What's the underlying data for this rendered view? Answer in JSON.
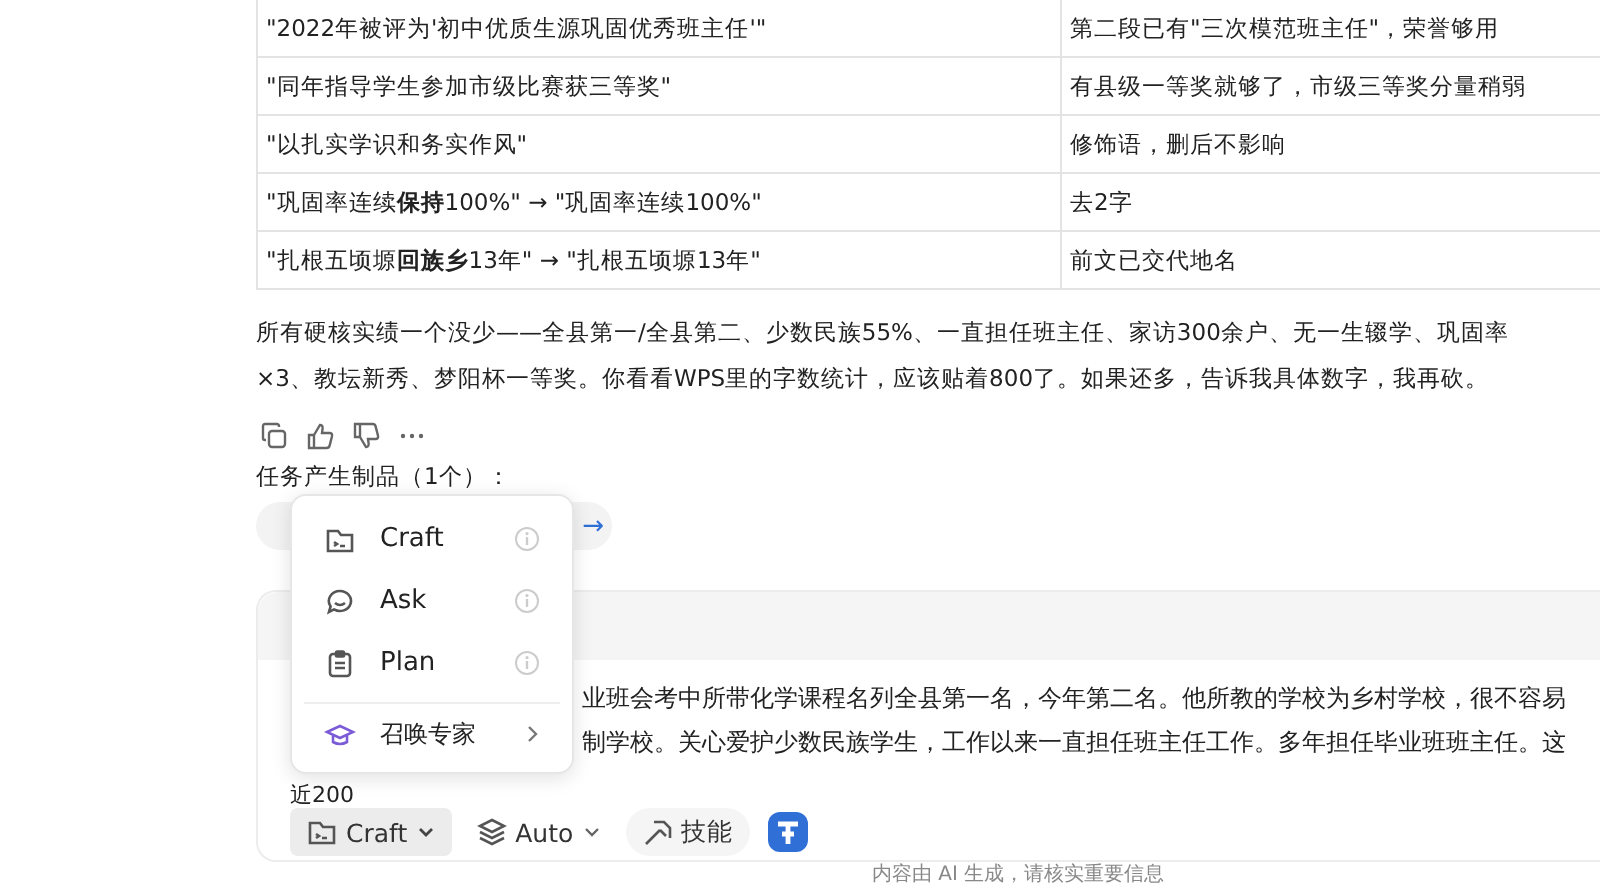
{
  "table": {
    "rows": [
      {
        "cells": [
          "\"2022年被评为'初中优质生源巩固优秀班主任'\"",
          "第二段已有\"三次模范班主任\"，荣誉够用"
        ]
      },
      {
        "cells": [
          "\"同年指导学生参加市级比赛获三等奖\"",
          "有县级一等奖就够了，市级三等奖分量稍弱"
        ]
      },
      {
        "cells": [
          "\"以扎实学识和务实作风\"",
          "修饰语，删后不影响"
        ]
      },
      {
        "cells": [
          "\"巩固率连续**保持**100%\" → \"巩固率连续100%\"",
          "去2字"
        ]
      },
      {
        "cells": [
          "\"扎根五顷塬**回族乡**13年\" → \"扎根五顷塬13年\"",
          "前文已交代地名"
        ]
      }
    ]
  },
  "reply_lines": [
    "所有硬核实绩一个没少——全县第一/全县第二、少数民族55%、一直担任班主任、家访300余户、无一生辍学、巩固率",
    "×3、教坛新秀、梦阳杯一等奖。你看看WPS里的字数统计，应该贴着800了。如果还多，告诉我具体数字，我再砍。"
  ],
  "artifacts": {
    "title": "任务产生制品（1个）：",
    "chip": "→"
  },
  "input": {
    "lines": [
      "业班会考中所带化学课程名列全县第一名，今年第二名。他所教的学校为乡村学校，很不容易",
      "制学校。关心爱护少数民族学生，工作以来一直担任班主任工作。多年担任毕业班班主任。这",
      "近200"
    ]
  },
  "toolbar": {
    "mode": "Craft",
    "model": "Auto",
    "skills": "技能"
  },
  "menu": {
    "items": [
      {
        "kind": "mode",
        "label": "Craft"
      },
      {
        "kind": "mode",
        "label": "Ask"
      },
      {
        "kind": "mode",
        "label": "Plan"
      },
      {
        "kind": "submenu",
        "label": "召唤专家"
      }
    ]
  },
  "footer": "内容由 AI 生成，请核实重要信息"
}
